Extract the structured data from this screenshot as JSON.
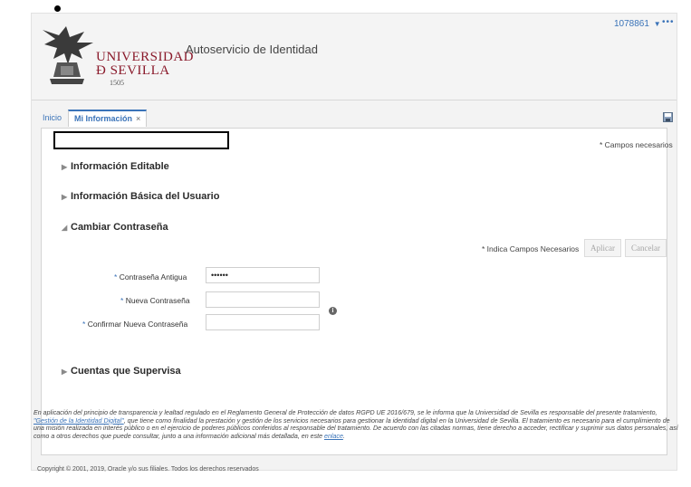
{
  "header": {
    "logo_line1": "UNIVERSIDAD",
    "logo_line2": "Ð SEVILLA",
    "logo_year": "1505",
    "app_title": "Autoservicio de Identidad",
    "user_id": "1078861",
    "user_menu_icon": "chevron-down-icon",
    "more_label": "•••"
  },
  "tabs": [
    {
      "label": "Inicio",
      "active": false
    },
    {
      "label": "Mi Información",
      "active": true,
      "close": "×"
    }
  ],
  "toolbar": {
    "save_icon": "save-icon"
  },
  "form": {
    "required_top": "* Campos necesarios",
    "sections": {
      "editable": "Información Editable",
      "basic": "Información Básica del Usuario",
      "password": "Cambiar Contraseña",
      "supervised": "Cuentas que Supervisa"
    },
    "required_inline": "* Indica Campos Necesarios",
    "apply_label": "Aplicar",
    "cancel_label": "Cancelar",
    "fields": {
      "old_password_label": "Contraseña Antigua",
      "old_password_value": "••••••",
      "new_password_label": "Nueva Contraseña",
      "new_password_value": "",
      "confirm_password_label": "Confirmar Nueva Contraseña",
      "confirm_password_value": ""
    },
    "required_star": "*",
    "info_icon": "info-icon"
  },
  "legal": {
    "part1": "En aplicación del principio de transparencia y lealtad regulado en el Reglamento General de Protección de datos RGPD UE 2016/679, se le informa que la Universidad de Sevilla es responsable del presente tratamiento, ",
    "link1": "\"Gestión de la Identidad Digital\"",
    "part2": ", que tiene como finalidad la prestación y gestión de los servicios necesarios para gestionar la identidad digital en la Universidad de Sevilla. El tratamiento es necesario para el cumplimiento de una misión realizada en interés público o en el ejercicio de poderes públicos conferidos al responsable del tratamiento. De acuerdo con las citadas normas, tiene derecho a acceder, rectificar y suprimir sus datos personales, así como a otros derechos que puede consultar, junto a una información adicional más detallada, en este ",
    "link2": "enlace",
    "part3": "."
  },
  "footer": {
    "copyright": "Copyright © 2001, 2019, Oracle y/o sus filiales. Todos los derechos reservados"
  },
  "colors": {
    "brand": "#8a1a2b",
    "link": "#3a73b8"
  }
}
